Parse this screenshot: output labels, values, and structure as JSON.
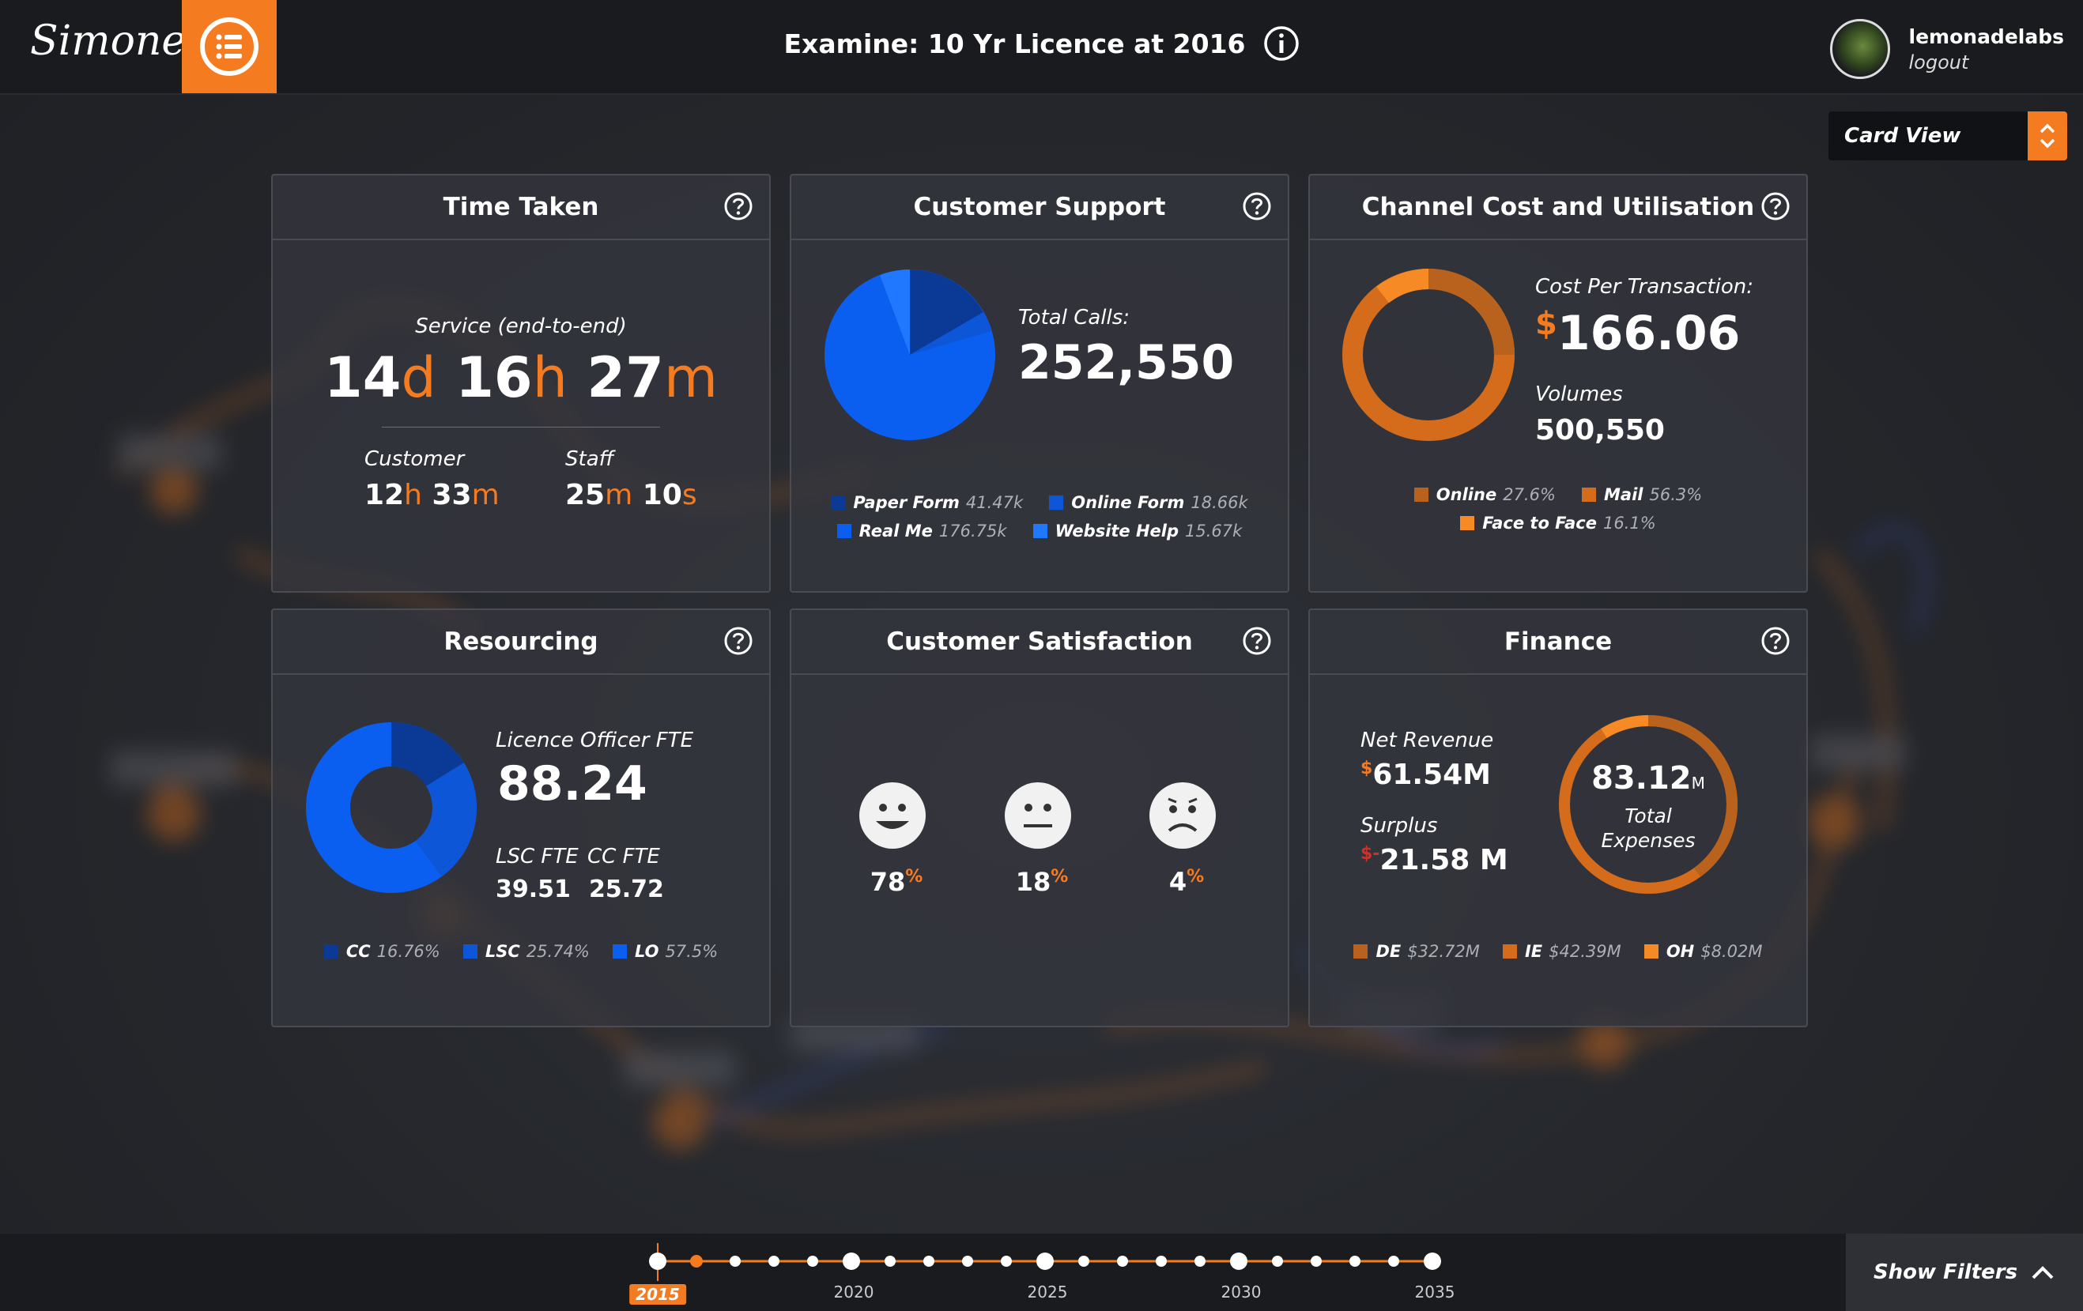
{
  "app": {
    "logo": "Simone",
    "title": "Examine: 10 Yr Licence at 2016"
  },
  "user": {
    "name": "lemonadelabs",
    "logout": "logout"
  },
  "view_select": {
    "value": "Card View"
  },
  "cards": {
    "time_taken": {
      "title": "Time Taken",
      "service_label": "Service (end-to-end)",
      "service": {
        "d": "14",
        "h": "16",
        "m": "27",
        "d_unit": "d",
        "h_unit": "h",
        "m_unit": "m"
      },
      "customer_label": "Customer",
      "customer": {
        "h": "12",
        "m": "33",
        "h_unit": "h",
        "m_unit": "m"
      },
      "staff_label": "Staff",
      "staff": {
        "m": "25",
        "s": "10",
        "m_unit": "m",
        "s_unit": "s"
      }
    },
    "customer_support": {
      "title": "Customer Support",
      "total_label": "Total Calls:",
      "total": "252,550",
      "legend": [
        {
          "label": "Paper Form",
          "value": "41.47k",
          "color": "#0a3a96"
        },
        {
          "label": "Online Form",
          "value": "18.66k",
          "color": "#0d56d8"
        },
        {
          "label": "Real Me",
          "value": "176.75k",
          "color": "#0a5ff0"
        },
        {
          "label": "Website Help",
          "value": "15.67k",
          "color": "#1f78ff"
        }
      ]
    },
    "channel_cost": {
      "title": "Channel Cost and Utilisation",
      "cpt_label": "Cost Per Transaction:",
      "cpt_currency": "$",
      "cpt": "166.06",
      "volumes_label": "Volumes",
      "volumes": "500,550",
      "legend": [
        {
          "label": "Online",
          "value": "27.6%",
          "color": "#b8621d"
        },
        {
          "label": "Mail",
          "value": "56.3%",
          "color": "#d46c1c"
        },
        {
          "label": "Face to Face",
          "value": "16.1%",
          "color": "#f68a24"
        }
      ]
    },
    "resourcing": {
      "title": "Resourcing",
      "lo_label": "Licence Officer FTE",
      "lo_value": "88.24",
      "lsc_label": "LSC FTE",
      "lsc_value": "39.51",
      "cc_label": "CC FTE",
      "cc_value": "25.72",
      "legend": [
        {
          "label": "CC",
          "value": "16.76%",
          "color": "#0a3a96"
        },
        {
          "label": "LSC",
          "value": "25.74%",
          "color": "#0d56d8"
        },
        {
          "label": "LO",
          "value": "57.5%",
          "color": "#0a5ff0"
        }
      ]
    },
    "satisfaction": {
      "title": "Customer Satisfaction",
      "faces": [
        {
          "icon": "happy-face-icon",
          "value": "78",
          "unit": "%"
        },
        {
          "icon": "neutral-face-icon",
          "value": "18",
          "unit": "%"
        },
        {
          "icon": "sad-face-icon",
          "value": "4",
          "unit": "%"
        }
      ]
    },
    "finance": {
      "title": "Finance",
      "net_label": "Net Revenue",
      "net_currency": "$",
      "net_value": "61.54M",
      "surplus_label": "Surplus",
      "surplus_currency": "$-",
      "surplus_value": "21.58 M",
      "expenses_value": "83.12",
      "expenses_unit": "M",
      "expenses_label": "Total Expenses",
      "legend": [
        {
          "label": "DE",
          "value": "$32.72M",
          "color": "#b8621d"
        },
        {
          "label": "IE",
          "value": "$42.39M",
          "color": "#d46c1c"
        },
        {
          "label": "OH",
          "value": "$8.02M",
          "color": "#f68a24"
        }
      ]
    }
  },
  "timeline": {
    "years": [
      "2015",
      "2020",
      "2025",
      "2030",
      "2035"
    ],
    "active_year": "2015"
  },
  "filters": {
    "label": "Show Filters"
  },
  "colors": {
    "accent": "#f47b20",
    "blue": "#0a5ff0",
    "dark_blue": "#0a3a96"
  }
}
